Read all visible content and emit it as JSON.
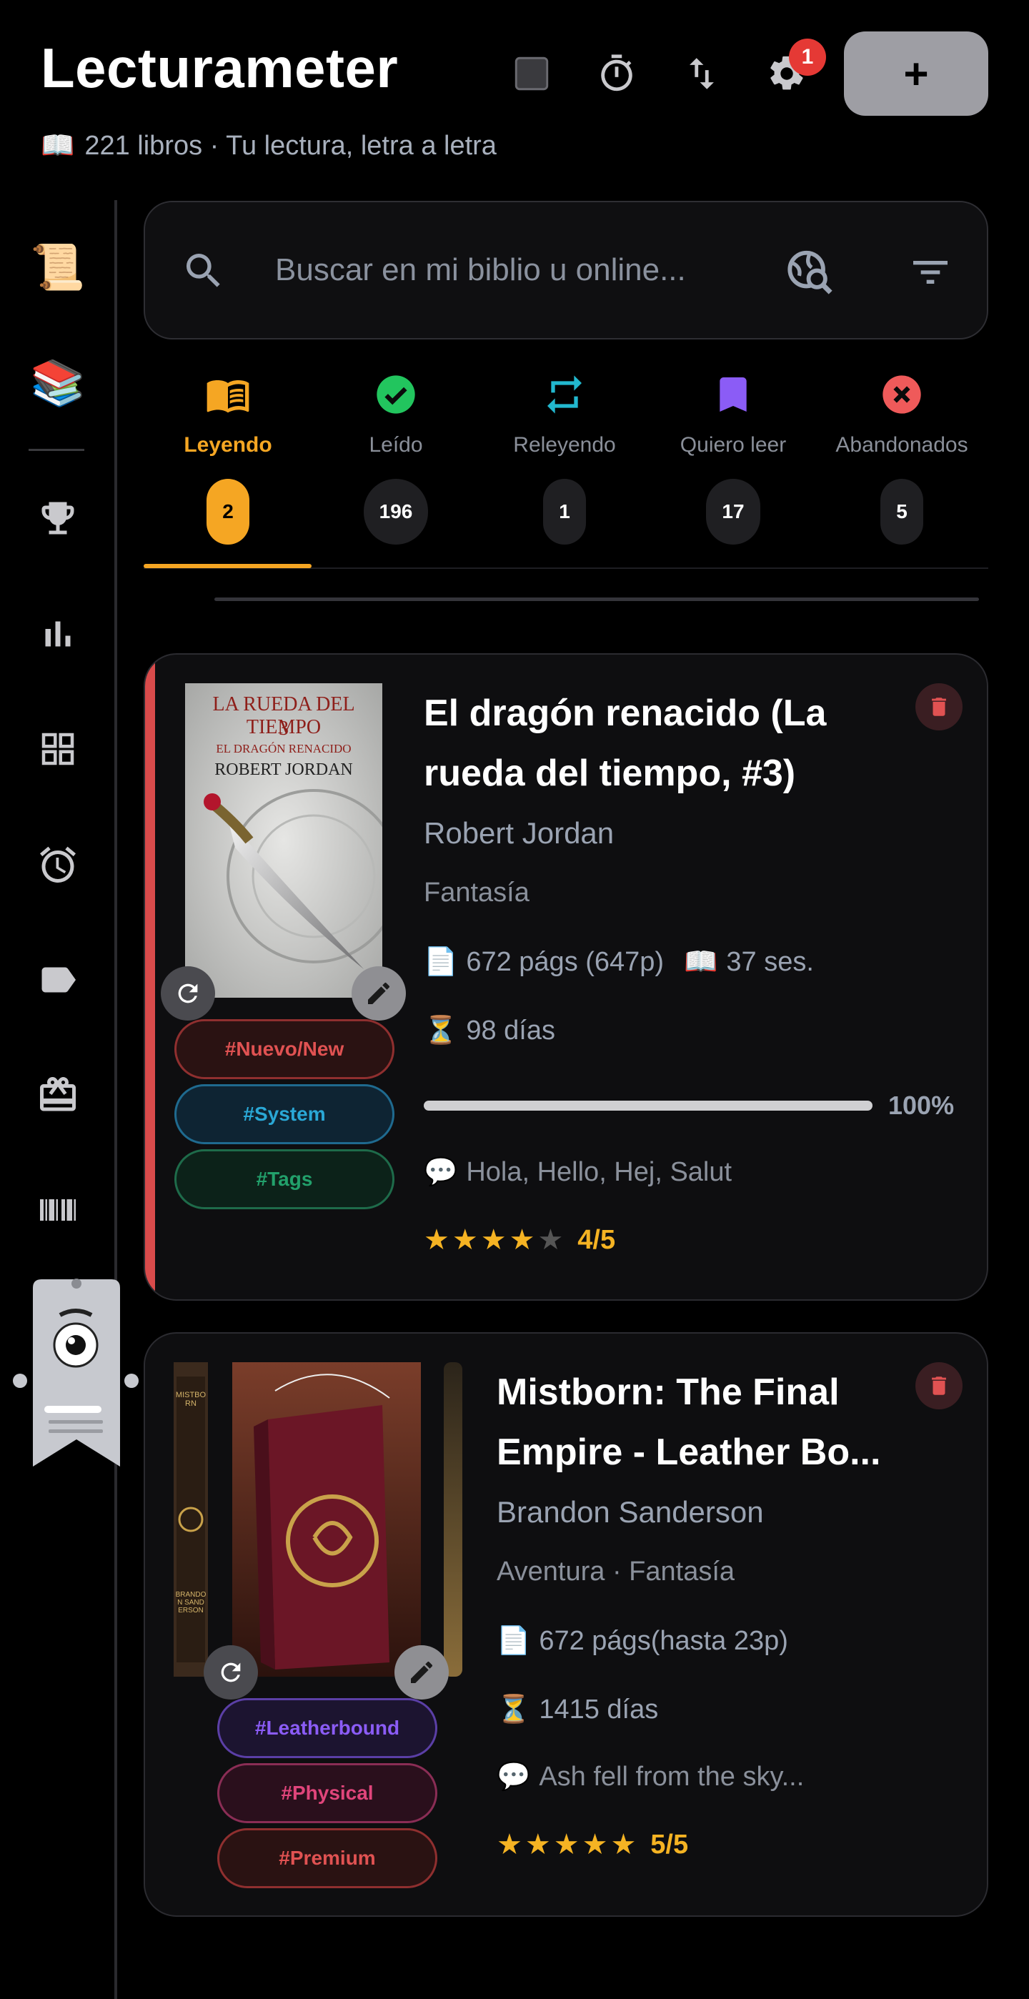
{
  "header": {
    "title": "Lecturameter",
    "subtitle_icon": "📖",
    "subtitle": "221 libros · Tu lectura, letra a letra",
    "settings_badge": "1",
    "add_label": "+",
    "icons": [
      "stop-icon",
      "timer-icon",
      "sort-arrows-icon",
      "gear-icon"
    ]
  },
  "sidebar": {
    "items": [
      {
        "name": "scroll-icon",
        "glyph": "📜"
      },
      {
        "name": "books-icon",
        "glyph": "📚"
      },
      {
        "name": "trophy-icon"
      },
      {
        "name": "bar-chart-icon"
      },
      {
        "name": "grid-icon"
      },
      {
        "name": "alarm-icon"
      },
      {
        "name": "tag-icon"
      },
      {
        "name": "gift-icon"
      },
      {
        "name": "barcode-icon"
      }
    ]
  },
  "search": {
    "placeholder": "Buscar en mi biblio u online..."
  },
  "tabs": [
    {
      "label": "Leyendo",
      "count": "2",
      "color": "#f5a623",
      "active": true
    },
    {
      "label": "Leído",
      "count": "196",
      "color": "#22c55e"
    },
    {
      "label": "Releyendo",
      "count": "1",
      "color": "#22b8cf"
    },
    {
      "label": "Quiero leer",
      "count": "17",
      "color": "#8b5cf6"
    },
    {
      "label": "Abandonados",
      "count": "5",
      "color": "#ef5a5a"
    }
  ],
  "books": [
    {
      "title_line1": "El dragón renacido (La",
      "title_line2": "rueda del tiempo, #3)",
      "author": "Robert Jordan",
      "genre": "Fantasía",
      "pages": "672 págs (647p)",
      "sessions": "37 ses.",
      "days": "98 días",
      "progress": 100,
      "progress_label": "100%",
      "note": "Hola, Hello, Hej, Salut",
      "rating": 4,
      "rating_label": "4/5",
      "cover_title1": "LA RUEDA DEL TIEMPO",
      "cover_num": "3",
      "cover_title2": "EL DRAGÓN RENACIDO",
      "cover_author": "ROBERT JORDAN",
      "tags": [
        {
          "label": "#Nuevo/New",
          "color": "#e05252"
        },
        {
          "label": "#System",
          "color": "#2aa8d6"
        },
        {
          "label": "#Tags",
          "color": "#22a06b"
        }
      ]
    },
    {
      "title_line1": "Mistborn: The Final",
      "title_line2": "Empire - Leather Bo...",
      "author": "Brandon Sanderson",
      "genre": "Aventura · Fantasía",
      "pages": "672 págs(hasta 23p)",
      "days": "1415 días",
      "note": "Ash fell from the sky...",
      "rating": 5,
      "rating_label": "5/5",
      "cover_spine": "MISTBORN",
      "cover_spine2": "BRANDON SANDERSON",
      "tags": [
        {
          "label": "#Leatherbound",
          "color": "#8b5cf6"
        },
        {
          "label": "#Physical",
          "color": "#e0457b"
        },
        {
          "label": "#Premium",
          "color": "#e05252"
        }
      ]
    }
  ],
  "emoji": {
    "page": "📄",
    "open_book": "📖",
    "hourglass": "⏳",
    "speech": "💬"
  }
}
